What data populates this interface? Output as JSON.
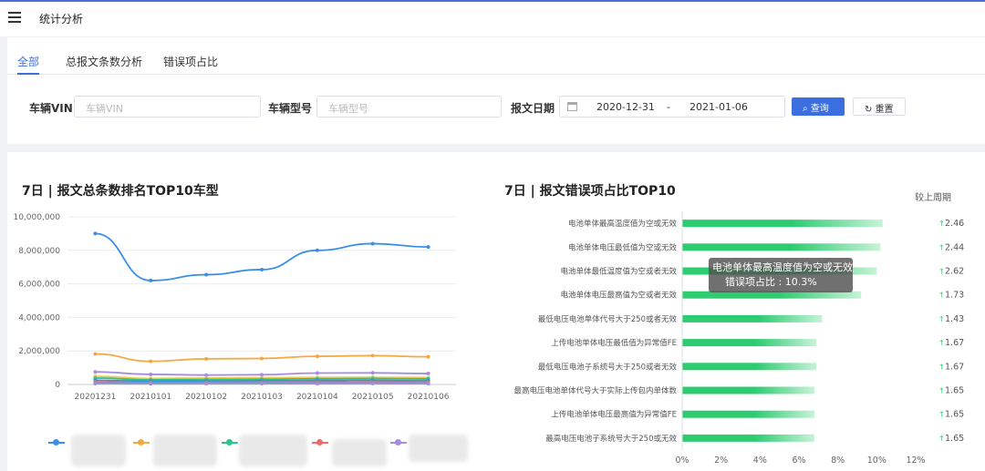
{
  "header": {
    "title": "统计分析"
  },
  "tabs": [
    {
      "label": "全部",
      "active": true
    },
    {
      "label": "总报文条数分析",
      "active": false
    },
    {
      "label": "错误项占比",
      "active": false
    }
  ],
  "filters": {
    "vin_label": "车辆VIN",
    "vin_placeholder": "车辆VIN",
    "model_label": "车辆型号",
    "model_placeholder": "车辆型号",
    "date_label": "报文日期",
    "date_start": "2020-12-31",
    "date_sep": "-",
    "date_end": "2021-01-06",
    "query_label": "查询",
    "reset_label": "重置"
  },
  "colors": {
    "accent": "#3b6fe0",
    "bar_green": "#2ecc71"
  },
  "left_chart": {
    "title": "7日 | 报文总条数排名TOP10车型"
  },
  "right_chart": {
    "title": "7日 | 报文错误项占比TOP10",
    "compare_label": "较上周期"
  },
  "tooltip": {
    "line1": "电池单体最高温度值为空或无效",
    "line2": "错误项占比 : 10.3%"
  },
  "chart_data": [
    {
      "type": "line",
      "x": [
        "20201231",
        "20210101",
        "20210102",
        "20210103",
        "20210104",
        "20210105",
        "20210106"
      ],
      "ylim": [
        0,
        10000000
      ],
      "yticks": [
        "0",
        "2,000,000",
        "4,000,000",
        "6,000,000",
        "8,000,000",
        "10,000,000"
      ],
      "series": [
        {
          "color": "#3a8ee6",
          "values": [
            9000000,
            6200000,
            6550000,
            6850000,
            8000000,
            8400000,
            8200000
          ]
        },
        {
          "color": "#f5a742",
          "values": [
            1820000,
            1380000,
            1530000,
            1550000,
            1680000,
            1720000,
            1650000
          ]
        },
        {
          "color": "#a78be0",
          "values": [
            750000,
            600000,
            560000,
            580000,
            680000,
            690000,
            650000
          ]
        },
        {
          "color": "#f2c94c",
          "values": [
            480000,
            360000,
            380000,
            400000,
            420000,
            430000,
            410000
          ]
        },
        {
          "color": "#2fc38b",
          "values": [
            380000,
            280000,
            300000,
            310000,
            340000,
            350000,
            330000
          ]
        },
        {
          "color": "#3a8ee6",
          "values": [
            250000,
            190000,
            210000,
            220000,
            240000,
            245000,
            230000
          ]
        },
        {
          "color": "#ef6a6a",
          "values": [
            150000,
            110000,
            120000,
            130000,
            140000,
            145000,
            135000
          ]
        },
        {
          "color": "#2fc38b",
          "values": [
            90000,
            70000,
            80000,
            85000,
            90000,
            92000,
            88000
          ]
        },
        {
          "color": "#a78be0",
          "values": [
            50000,
            40000,
            45000,
            47000,
            50000,
            52000,
            49000
          ]
        }
      ]
    },
    {
      "type": "bar",
      "orientation": "horizontal",
      "xlim": [
        0,
        12
      ],
      "xticks": [
        "0%",
        "2%",
        "4%",
        "6%",
        "8%",
        "10%",
        "12%"
      ],
      "categories": [
        "电池单体最高温度值为空或无效",
        "电池单体电压最低值为空或无效",
        "电池单体最低温度值为空或者无效",
        "电池单体电压最高值为空或者无效",
        "最低电压电池单体代号大于250或者无效",
        "上传电池单体电压最低值为异常值FE",
        "最低电压电池子系统号大于250或者无效",
        "最高电压电池单体代号大于实际上传包内单体数",
        "上传电池单体电压最高值为异常值FE",
        "最高电压电池子系统号大于250或无效"
      ],
      "values": [
        10.3,
        10.2,
        10.0,
        9.2,
        7.2,
        6.9,
        6.9,
        6.8,
        6.8,
        6.8
      ],
      "changes": [
        "2.46",
        "2.44",
        "2.62",
        "1.73",
        "1.43",
        "1.67",
        "1.67",
        "1.65",
        "1.65",
        "1.65"
      ],
      "change_arrow": "↑"
    }
  ]
}
